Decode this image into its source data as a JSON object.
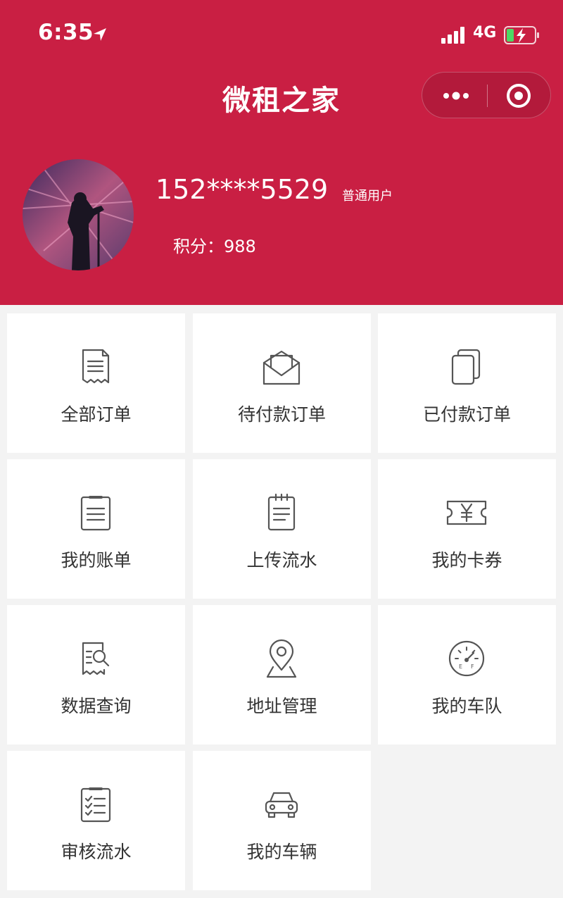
{
  "status_bar": {
    "time": "6:35",
    "network": "4G",
    "icons": [
      "location-arrow-icon",
      "signal-bars-icon",
      "battery-charging-icon"
    ]
  },
  "nav": {
    "title": "微租之家",
    "capsule_icons": [
      "more-dots-icon",
      "close-target-icon"
    ]
  },
  "profile": {
    "phone": "152****5529",
    "user_type": "普通用户",
    "points_label": "积分：988"
  },
  "theme": {
    "primary": "#c91f43",
    "background": "#f3f3f3",
    "icon_color": "#555555",
    "text_color": "#333333"
  },
  "menu": [
    {
      "label": "全部订单",
      "icon": "receipt-icon"
    },
    {
      "label": "待付款订单",
      "icon": "envelope-icon"
    },
    {
      "label": "已付款订单",
      "icon": "copy-cards-icon"
    },
    {
      "label": "我的账单",
      "icon": "clipboard-list-icon"
    },
    {
      "label": "上传流水",
      "icon": "notepad-icon"
    },
    {
      "label": "我的卡券",
      "icon": "coupon-yen-icon"
    },
    {
      "label": "数据查询",
      "icon": "document-search-icon"
    },
    {
      "label": "地址管理",
      "icon": "map-pin-icon"
    },
    {
      "label": "我的车队",
      "icon": "fuel-gauge-icon"
    },
    {
      "label": "审核流水",
      "icon": "checklist-icon"
    },
    {
      "label": "我的车辆",
      "icon": "car-icon"
    }
  ]
}
